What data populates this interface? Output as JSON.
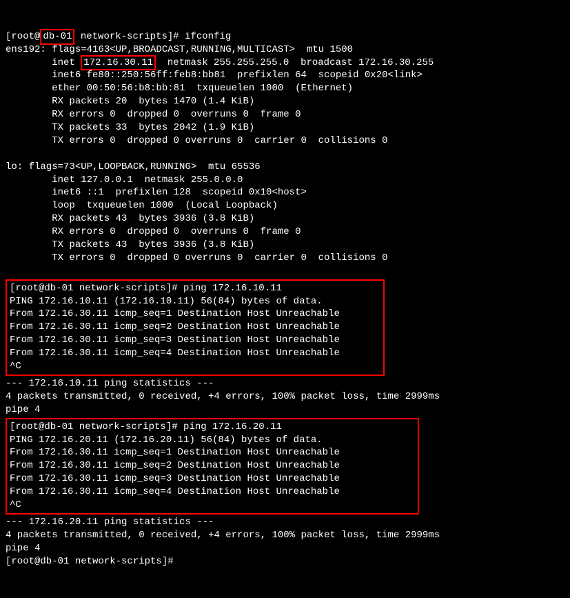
{
  "line1_a": "[root@",
  "line1_host": "db-01",
  "line1_b": " network-scripts]# ifconfig",
  "ifc": {
    "l1": "ens192: flags=4163<UP,BROADCAST,RUNNING,MULTICAST>  mtu 1500",
    "l2a": "        inet ",
    "l2_ip": "172.16.30.11",
    "l2b": "  netmask 255.255.255.0  broadcast 172.16.30.255",
    "l3": "        inet6 fe80::250:56ff:feb8:bb81  prefixlen 64  scopeid 0x20<link>",
    "l4": "        ether 00:50:56:b8:bb:81  txqueuelen 1000  (Ethernet)",
    "l5": "        RX packets 20  bytes 1470 (1.4 KiB)",
    "l6": "        RX errors 0  dropped 0  overruns 0  frame 0",
    "l7": "        TX packets 33  bytes 2042 (1.9 KiB)",
    "l8": "        TX errors 0  dropped 0 overruns 0  carrier 0  collisions 0"
  },
  "lo": {
    "l1": "lo: flags=73<UP,LOOPBACK,RUNNING>  mtu 65536",
    "l2": "        inet 127.0.0.1  netmask 255.0.0.0",
    "l3": "        inet6 ::1  prefixlen 128  scopeid 0x10<host>",
    "l4": "        loop  txqueuelen 1000  (Local Loopback)",
    "l5": "        RX packets 43  bytes 3936 (3.8 KiB)",
    "l6": "        RX errors 0  dropped 0  overruns 0  frame 0",
    "l7": "        TX packets 43  bytes 3936 (3.8 KiB)",
    "l8": "        TX errors 0  dropped 0 overruns 0  carrier 0  collisions 0"
  },
  "ping1": {
    "cmd": "[root@db-01 network-scripts]# ping 172.16.10.11",
    "l1": "PING 172.16.10.11 (172.16.10.11) 56(84) bytes of data.",
    "l2": "From 172.16.30.11 icmp_seq=1 Destination Host Unreachable",
    "l3": "From 172.16.30.11 icmp_seq=2 Destination Host Unreachable",
    "l4": "From 172.16.30.11 icmp_seq=3 Destination Host Unreachable",
    "l5": "From 172.16.30.11 icmp_seq=4 Destination Host Unreachable",
    "l6": "^C"
  },
  "ping1_stats": {
    "l1": "--- 172.16.10.11 ping statistics ---",
    "l2": "4 packets transmitted, 0 received, +4 errors, 100% packet loss, time 2999ms",
    "l3": "pipe 4"
  },
  "ping2": {
    "cmd": "[root@db-01 network-scripts]# ping 172.16.20.11",
    "l1": "PING 172.16.20.11 (172.16.20.11) 56(84) bytes of data.",
    "l2": "From 172.16.30.11 icmp_seq=1 Destination Host Unreachable",
    "l3": "From 172.16.30.11 icmp_seq=2 Destination Host Unreachable",
    "l4": "From 172.16.30.11 icmp_seq=3 Destination Host Unreachable",
    "l5": "From 172.16.30.11 icmp_seq=4 Destination Host Unreachable",
    "l6": "^C"
  },
  "ping2_stats": {
    "l1": "--- 172.16.20.11 ping statistics ---",
    "l2": "4 packets transmitted, 0 received, +4 errors, 100% packet loss, time 2999ms",
    "l3": "pipe 4"
  },
  "final_prompt": "[root@db-01 network-scripts]#"
}
